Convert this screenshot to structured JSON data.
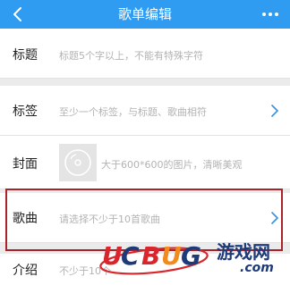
{
  "header": {
    "title": "歌单编辑",
    "back_icon": "chevron-left-icon",
    "more_icon": "more-dots-icon",
    "background": "#2f9bf1"
  },
  "form": {
    "title": {
      "label": "标题",
      "placeholder": "标题5个字以上，不能有特殊字符"
    },
    "tags": {
      "label": "标签",
      "placeholder": "至少一个标签，与标题、歌曲相符"
    },
    "cover": {
      "label": "封面",
      "placeholder": "大于600*600的图片，清晰美观"
    },
    "songs": {
      "label": "歌曲",
      "placeholder": "请选择不少于10首歌曲"
    },
    "intro": {
      "label": "介绍",
      "placeholder": "不少于10个"
    }
  },
  "highlight": {
    "color": "#a8232a",
    "target": "songs"
  },
  "watermark": {
    "logo_text": "UCBUG",
    "site_cn": "游戏网",
    "site_domain": ".com"
  }
}
